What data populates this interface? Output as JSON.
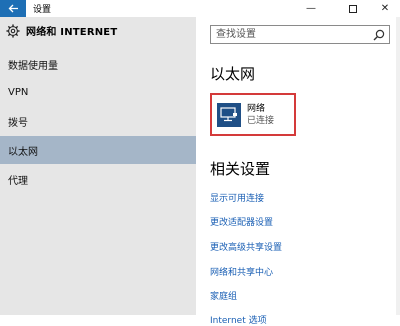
{
  "window": {
    "title": "设置",
    "back_icon": "arrow-left-icon",
    "controls": [
      "minimize-icon",
      "maximize-icon",
      "close-icon"
    ]
  },
  "sidebar": {
    "header": {
      "icon": "gear-icon",
      "title": "网络和 INTERNET"
    },
    "items": [
      {
        "label": "数据使用量",
        "active": false
      },
      {
        "label": "VPN",
        "active": false
      },
      {
        "label": "拨号",
        "active": false
      },
      {
        "label": "以太网",
        "active": true
      },
      {
        "label": "代理",
        "active": false
      }
    ]
  },
  "search": {
    "placeholder": "查找设置",
    "icon": "search-icon"
  },
  "main": {
    "heading": "以太网",
    "network": {
      "icon": "monitor-network-icon",
      "name": "网络",
      "status": "已连接"
    },
    "related_title": "相关设置",
    "links": [
      "显示可用连接",
      "更改适配器设置",
      "更改高级共享设置",
      "网络和共享中心",
      "家庭组",
      "Internet 选项"
    ]
  },
  "colors": {
    "accent": "#1e6fb5",
    "active_nav": "#a5b6c8",
    "highlight_border": "#d43a3a",
    "link": "#1a5fb4"
  }
}
